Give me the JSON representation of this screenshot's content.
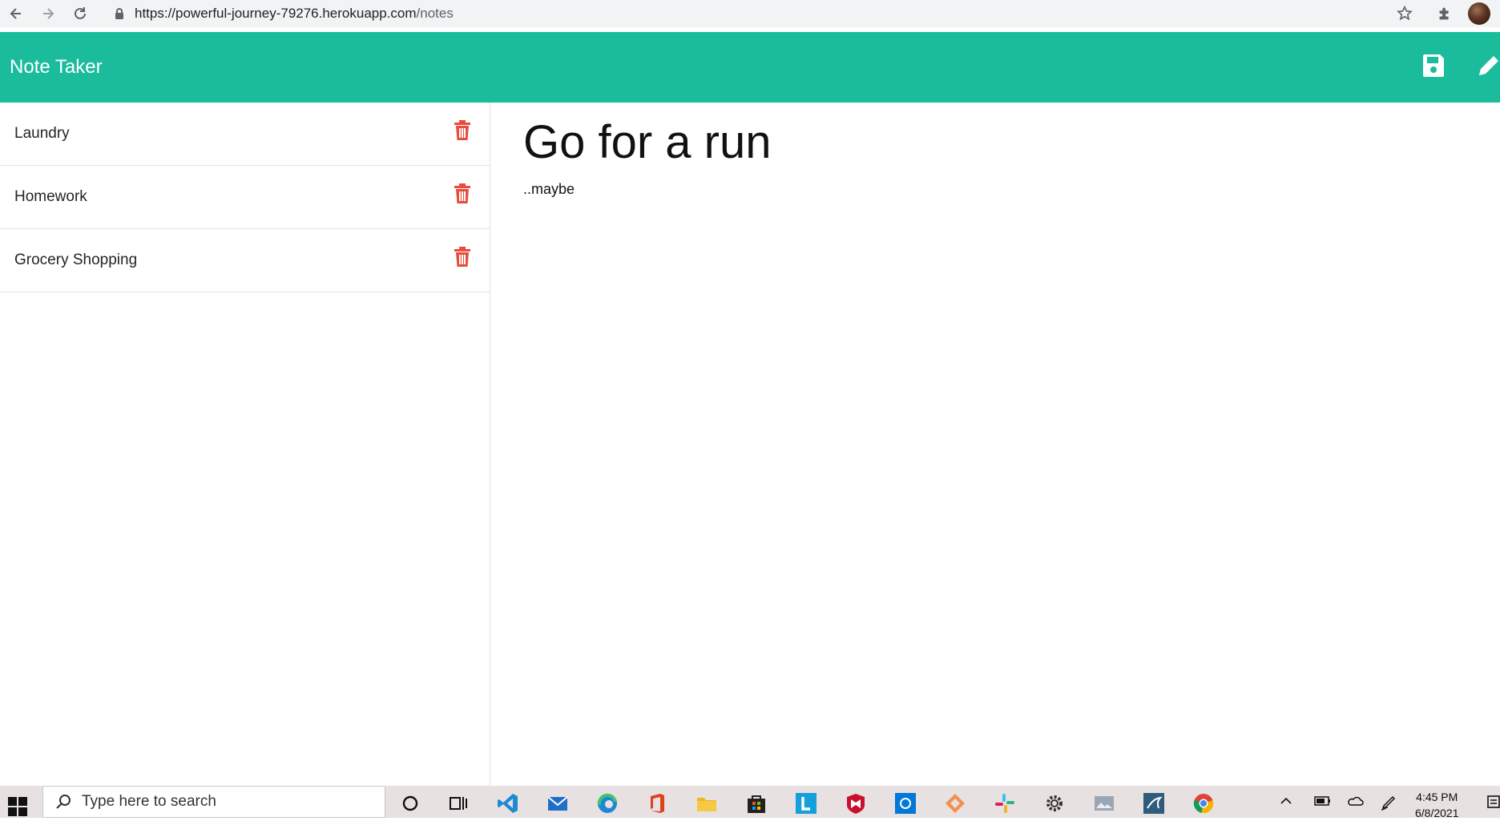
{
  "browser": {
    "url_host": "https://powerful-journey-79276.herokuapp.com",
    "url_path": "/notes"
  },
  "header": {
    "title": "Note Taker",
    "save_icon": "save-icon",
    "edit_icon": "pencil-icon"
  },
  "notes": [
    {
      "title": "Laundry"
    },
    {
      "title": "Homework"
    },
    {
      "title": "Grocery Shopping"
    }
  ],
  "active_note": {
    "title": "Go for a run",
    "text": "..maybe"
  },
  "colors": {
    "header_bg": "#1abc9c",
    "delete_icon": "#e74c3c"
  },
  "taskbar": {
    "search_placeholder": "Type here to search",
    "time": "4:45 PM",
    "date": "6/8/2021"
  }
}
